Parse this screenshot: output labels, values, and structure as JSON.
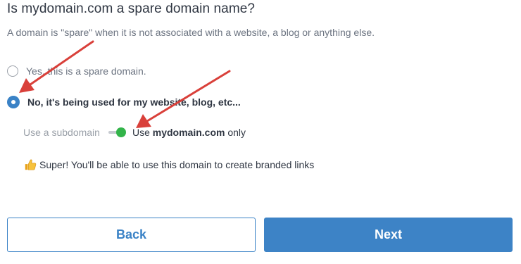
{
  "header": {
    "title": "Is mydomain.com a spare domain name?",
    "description": "A domain is \"spare\" when it is not associated with a website, a blog or anything else."
  },
  "options": [
    {
      "label": "Yes, this is a spare domain.",
      "selected": false
    },
    {
      "label": "No, it's being used for my website, blog, etc...",
      "selected": true
    }
  ],
  "subdomain_toggle": {
    "left_label": "Use a subdomain",
    "right_prefix": "Use ",
    "right_domain": "mydomain.com",
    "right_suffix": " only",
    "state": "on",
    "knob_color": "#33b44a"
  },
  "info": {
    "icon": "thumbs-up-icon",
    "text": "Super! You'll be able to use this domain to create branded links"
  },
  "buttons": {
    "back_label": "Back",
    "next_label": "Next"
  },
  "colors": {
    "accent": "#3a82c6",
    "annotation_arrow": "#d9403a"
  }
}
